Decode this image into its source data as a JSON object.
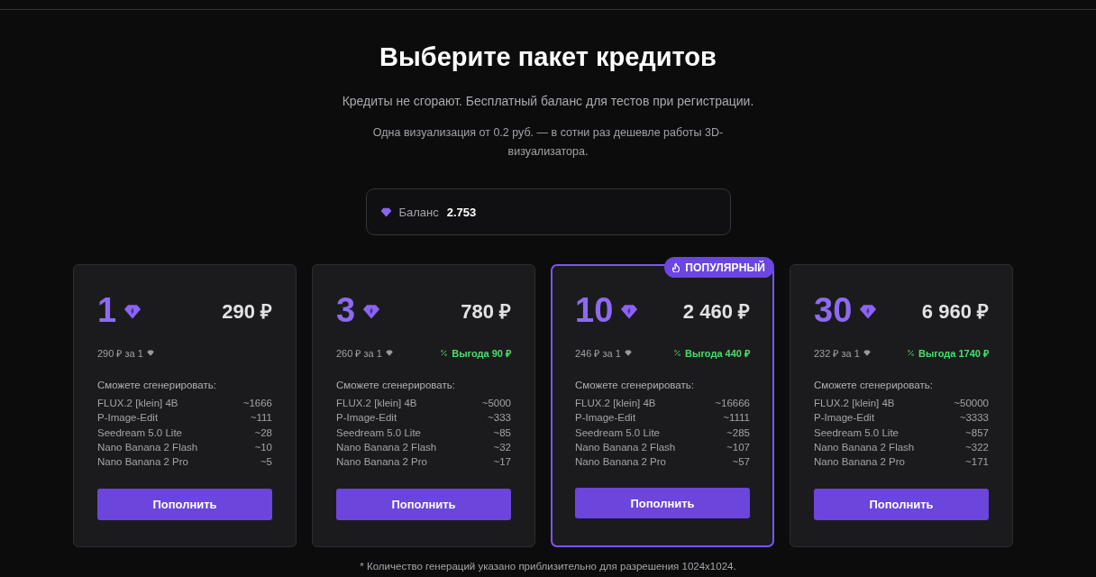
{
  "heading": {
    "title": "Выберите пакет кредитов",
    "subtitle": "Кредиты не сгорают. Бесплатный баланс для тестов при регистрации.",
    "note": "Одна визуализация от 0.2 руб. — в сотни раз дешевле работы 3D-визуализатора."
  },
  "balance": {
    "label": "Баланс",
    "value": "2.753"
  },
  "packages": [
    {
      "credits": "1",
      "price": "290 ₽",
      "unit_price": "290 ₽ за 1",
      "popular": false,
      "estimates_heading": "Сможете сгенерировать:",
      "estimates": [
        {
          "model": "FLUX.2 [klein] 4B",
          "count": "~1666"
        },
        {
          "model": "P-Image-Edit",
          "count": "~111"
        },
        {
          "model": "Seedream 5.0 Lite",
          "count": "~28"
        },
        {
          "model": "Nano Banana 2 Flash",
          "count": "~10"
        },
        {
          "model": "Nano Banana 2 Pro",
          "count": "~5"
        }
      ],
      "button": "Пополнить"
    },
    {
      "credits": "3",
      "price": "780 ₽",
      "unit_price": "260 ₽ за 1",
      "savings": "Выгода 90 ₽",
      "popular": false,
      "estimates_heading": "Сможете сгенерировать:",
      "estimates": [
        {
          "model": "FLUX.2 [klein] 4B",
          "count": "~5000"
        },
        {
          "model": "P-Image-Edit",
          "count": "~333"
        },
        {
          "model": "Seedream 5.0 Lite",
          "count": "~85"
        },
        {
          "model": "Nano Banana 2 Flash",
          "count": "~32"
        },
        {
          "model": "Nano Banana 2 Pro",
          "count": "~17"
        }
      ],
      "button": "Пополнить"
    },
    {
      "credits": "10",
      "price": "2 460 ₽",
      "unit_price": "246 ₽ за 1",
      "savings": "Выгода 440 ₽",
      "popular": true,
      "badge": "ПОПУЛЯРНЫЙ",
      "estimates_heading": "Сможете сгенерировать:",
      "estimates": [
        {
          "model": "FLUX.2 [klein] 4B",
          "count": "~16666"
        },
        {
          "model": "P-Image-Edit",
          "count": "~1111"
        },
        {
          "model": "Seedream 5.0 Lite",
          "count": "~285"
        },
        {
          "model": "Nano Banana 2 Flash",
          "count": "~107"
        },
        {
          "model": "Nano Banana 2 Pro",
          "count": "~57"
        }
      ],
      "button": "Пополнить"
    },
    {
      "credits": "30",
      "price": "6 960 ₽",
      "unit_price": "232 ₽ за 1",
      "savings": "Выгода 1740 ₽",
      "popular": false,
      "estimates_heading": "Сможете сгенерировать:",
      "estimates": [
        {
          "model": "FLUX.2 [klein] 4B",
          "count": "~50000"
        },
        {
          "model": "P-Image-Edit",
          "count": "~3333"
        },
        {
          "model": "Seedream 5.0 Lite",
          "count": "~857"
        },
        {
          "model": "Nano Banana 2 Flash",
          "count": "~322"
        },
        {
          "model": "Nano Banana 2 Pro",
          "count": "~171"
        }
      ],
      "button": "Пополнить"
    }
  ],
  "footnote": "* Количество генераций указано приблизительно для разрешения 1024x1024."
}
